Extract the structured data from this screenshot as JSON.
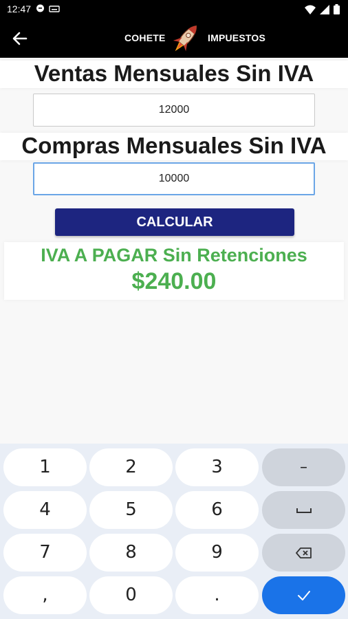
{
  "status_bar": {
    "time": "12:47"
  },
  "app_bar": {
    "brand_left": "COHETE",
    "brand_right": "IMPUESTOS"
  },
  "form": {
    "ventas_label": "Ventas Mensuales Sin IVA",
    "ventas_value": "12000",
    "compras_label": "Compras Mensuales Sin IVA",
    "compras_value": "10000",
    "calc_button": "CALCULAR"
  },
  "result": {
    "title": "IVA A PAGAR Sin Retenciones",
    "value": "$240.00"
  },
  "keyboard": {
    "rows": [
      [
        "1",
        "2",
        "3",
        "–"
      ],
      [
        "4",
        "5",
        "6",
        "space"
      ],
      [
        "7",
        "8",
        "9",
        "backspace"
      ],
      [
        ",",
        "0",
        ".",
        "enter"
      ]
    ],
    "keys": {
      "k1": "1",
      "k2": "2",
      "k3": "3",
      "minus": "–",
      "k4": "4",
      "k5": "5",
      "k6": "6",
      "k7": "7",
      "k8": "8",
      "k9": "9",
      "comma": ",",
      "k0": "0",
      "period": "."
    }
  },
  "colors": {
    "app_bar": "#000000",
    "button": "#1d2580",
    "result_green": "#4caf50",
    "enter_key": "#1a73e8"
  }
}
